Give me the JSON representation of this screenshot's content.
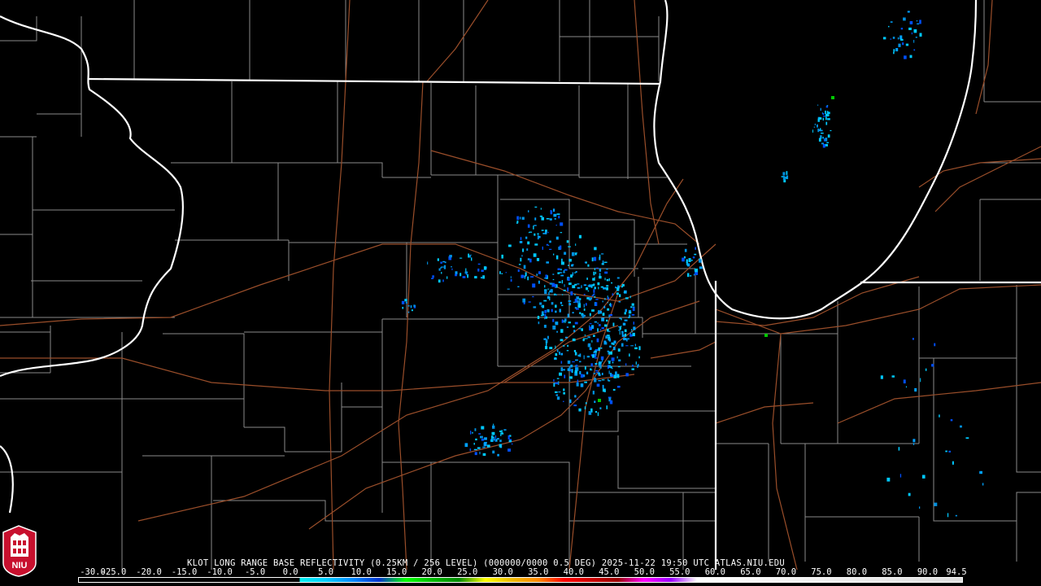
{
  "product_title": "KLOT LONG RANGE BASE REFLECTIVITY (0.25KM / 256 LEVEL) (000000/0000 0.5 DEG) 2025-11-22 19:50 UTC  ATLAS.NIU.EDU",
  "scale_labels": [
    "-30.0",
    "-25.0",
    "-20.0",
    "-15.0",
    "-10.0",
    "-5.0",
    "0.0",
    "5.0",
    "10.0",
    "15.0",
    "20.0",
    "25.0",
    "30.0",
    "35.0",
    "40.0",
    "45.0",
    "50.0",
    "55.0",
    "60.0",
    "65.0",
    "70.0",
    "75.0",
    "80.0",
    "85.0",
    "90.0",
    "94.5"
  ],
  "logo_text": "NIU",
  "colors": {
    "background": "#000000",
    "state_border": "#ffffff",
    "county_border": "#8c8c8c",
    "highway": "#a0522d",
    "echo_light": "#00c8ff",
    "echo_mid": "#0050ff",
    "echo_green": "#00c800",
    "logo_red": "#c8102e"
  },
  "icons": {
    "logo": "niu-logo-icon"
  }
}
